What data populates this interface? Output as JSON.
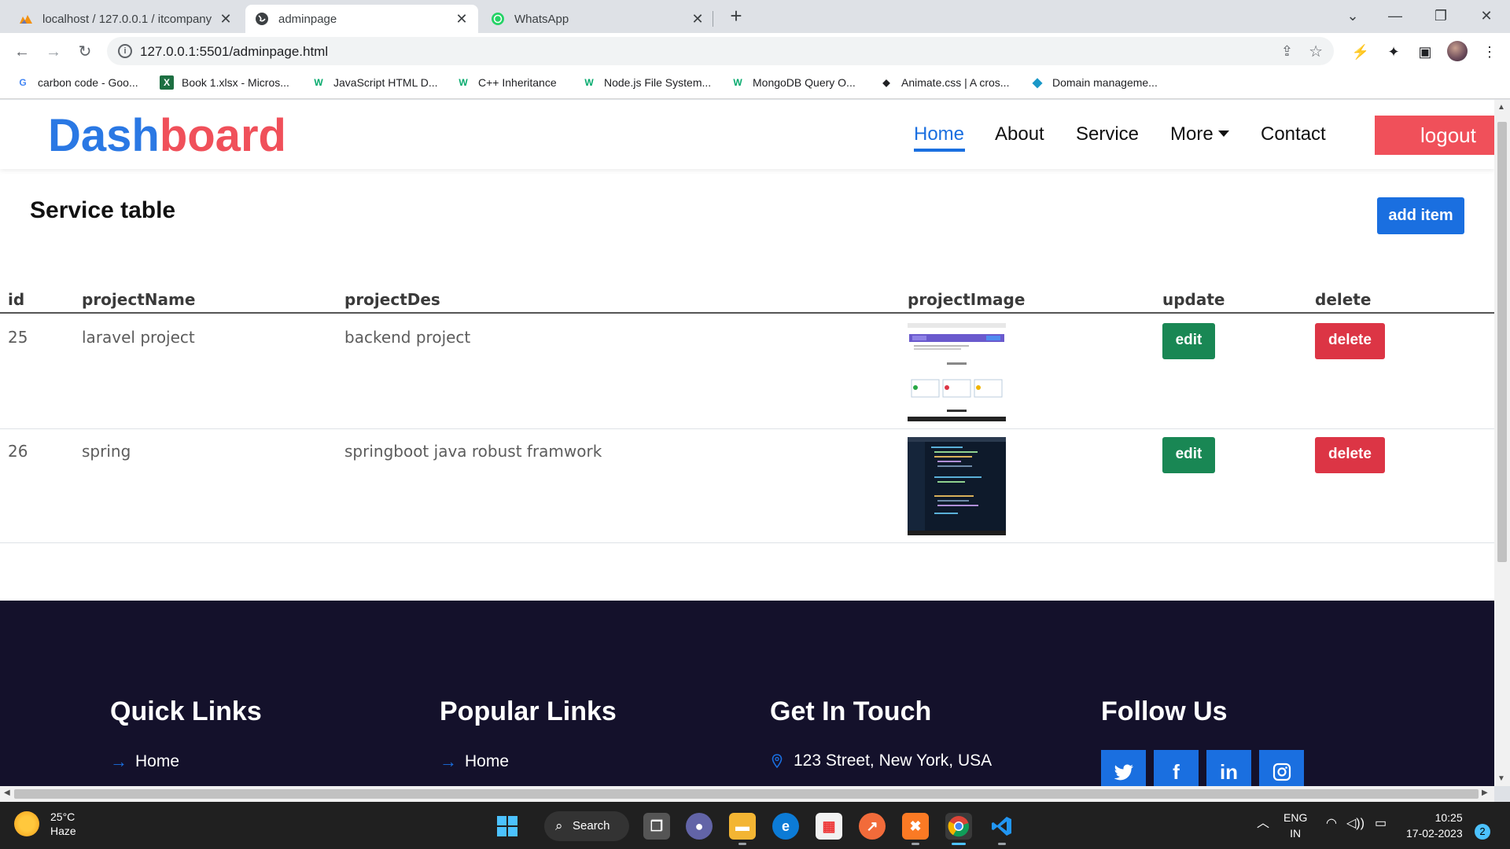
{
  "browser": {
    "tabs": [
      {
        "title": "localhost / 127.0.0.1 / itcompany",
        "icon": "phpmyadmin-icon"
      },
      {
        "title": "adminpage",
        "icon": "globe-icon"
      },
      {
        "title": "WhatsApp",
        "icon": "whatsapp-icon"
      }
    ],
    "active_tab": 1,
    "url": "127.0.0.1:5501/adminpage.html",
    "bookmarks": [
      {
        "label": "carbon code - Goo...",
        "icon": "google-icon"
      },
      {
        "label": "Book 1.xlsx - Micros...",
        "icon": "excel-icon"
      },
      {
        "label": "JavaScript HTML D...",
        "icon": "w3schools-icon"
      },
      {
        "label": "C++ Inheritance",
        "icon": "w3schools-icon"
      },
      {
        "label": "Node.js File System...",
        "icon": "w3schools-icon"
      },
      {
        "label": "MongoDB Query O...",
        "icon": "w3schools-icon"
      },
      {
        "label": "Animate.css | A cros...",
        "icon": "animate-icon"
      },
      {
        "label": "Domain manageme...",
        "icon": "diamond-icon"
      }
    ]
  },
  "nav": {
    "brand_part1": "Dash",
    "brand_part2": "board",
    "items": [
      "Home",
      "About",
      "Service",
      "More",
      "Contact"
    ],
    "logout": "logout",
    "colors": {
      "brand_blue": "#2a78e4",
      "brand_red": "#f0505a"
    }
  },
  "service": {
    "title": "Service table",
    "add_button": "add item",
    "columns": [
      "id",
      "projectName",
      "projectDes",
      "projectImage",
      "update",
      "delete"
    ],
    "rows": [
      {
        "id": "25",
        "name": "laravel project",
        "desc": "backend project",
        "edit": "edit",
        "delete": "delete"
      },
      {
        "id": "26",
        "name": "spring",
        "desc": "springboot java robust framwork",
        "edit": "edit",
        "delete": "delete"
      }
    ]
  },
  "footer": {
    "quick_links": {
      "title": "Quick Links",
      "first": "Home"
    },
    "popular_links": {
      "title": "Popular Links",
      "first": "Home"
    },
    "contact": {
      "title": "Get In Touch",
      "address": "123 Street, New York, USA"
    },
    "follow": {
      "title": "Follow Us",
      "social": [
        "twitter",
        "facebook",
        "linkedin",
        "instagram"
      ]
    }
  },
  "taskbar": {
    "temperature": "25°C",
    "weather": "Haze",
    "search": "Search",
    "lang_top": "ENG",
    "lang_bottom": "IN",
    "time": "10:25",
    "date": "17-02-2023",
    "notifications": "2"
  }
}
